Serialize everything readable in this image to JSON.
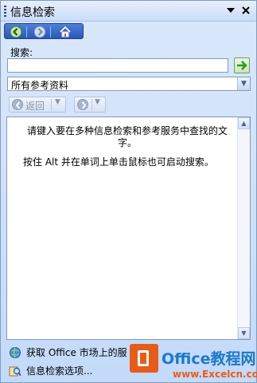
{
  "pane": {
    "title": "信息检索",
    "icons": {
      "menu": "dropdown-triangle-icon",
      "close": "close-icon"
    }
  },
  "nav": {
    "back_icon": "back-arrow-icon",
    "forward_icon": "forward-arrow-icon",
    "home_icon": "home-icon"
  },
  "search": {
    "label": "搜索:",
    "value": "",
    "placeholder": "",
    "go_icon": "go-arrow-icon",
    "scope_selected": "所有参考资料"
  },
  "history": {
    "back_label": "返回"
  },
  "results": {
    "message_line1": "请键入要在多种信息检索和参考服务中查找的文字。",
    "message_line2": "按住 Alt 并在单词上单击鼠标也可启动搜索。"
  },
  "footer": {
    "market_link": "获取 Office 市场上的服",
    "options_link": "信息检索选项..."
  },
  "watermark": {
    "brand": "Office教程网",
    "url": "www.Excelcn.com"
  },
  "colors": {
    "accent": "#2a57b8",
    "go_green": "#2f9b1f",
    "watermark_orange": "#e85c1a",
    "watermark_blue": "#1d79c8"
  }
}
